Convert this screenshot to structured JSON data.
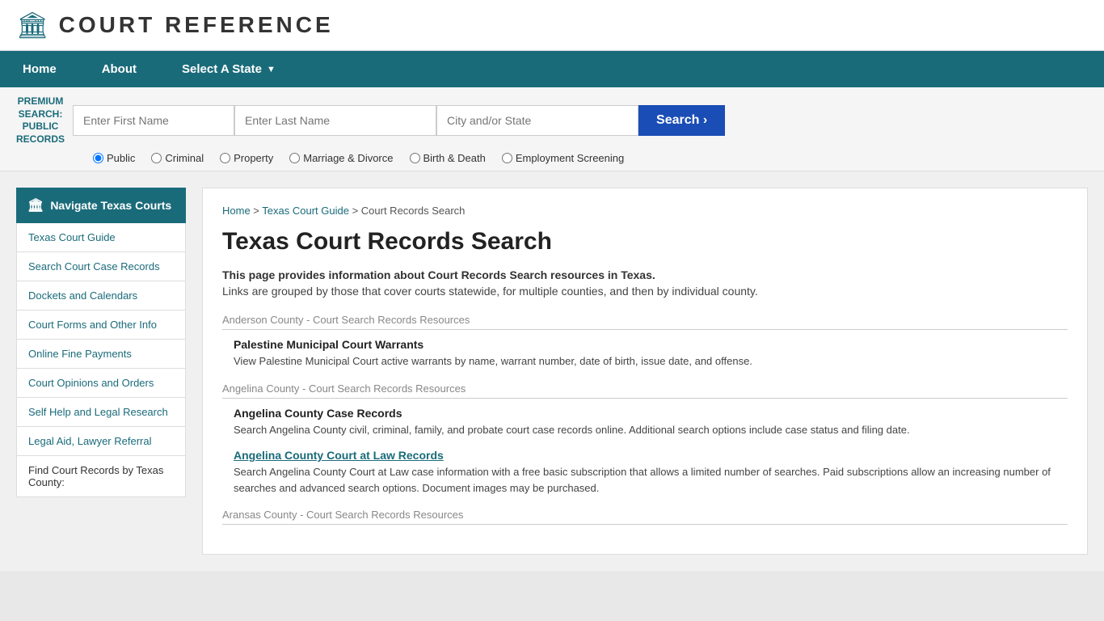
{
  "header": {
    "logo_icon": "🏛",
    "site_title": "COURT REFERENCE"
  },
  "nav": {
    "items": [
      {
        "label": "Home",
        "has_arrow": false
      },
      {
        "label": "About",
        "has_arrow": false
      },
      {
        "label": "Select A State",
        "has_arrow": true
      }
    ]
  },
  "search_bar": {
    "premium_label": "PREMIUM\nSEARCH:\nPUBLIC\nRECORDS",
    "first_name_placeholder": "Enter First Name",
    "last_name_placeholder": "Enter Last Name",
    "city_placeholder": "City and/or State",
    "button_label": "Search  ›",
    "radio_options": [
      "Public",
      "Criminal",
      "Property",
      "Marriage & Divorce",
      "Birth & Death",
      "Employment Screening"
    ],
    "radio_selected": "Public"
  },
  "breadcrumb": {
    "home": "Home",
    "state": "Texas Court Guide",
    "current": "Court Records Search"
  },
  "page": {
    "title": "Texas Court Records Search",
    "intro_bold": "This page provides information about Court Records Search resources in Texas.",
    "intro_text": "Links are grouped by those that cover courts statewide, for multiple counties, and then by individual county."
  },
  "sidebar": {
    "header_label": "Navigate Texas Courts",
    "links": [
      "Texas Court Guide",
      "Search Court Case Records",
      "Dockets and Calendars",
      "Court Forms and Other Info",
      "Online Fine Payments",
      "Court Opinions and Orders",
      "Self Help and Legal Research",
      "Legal Aid, Lawyer Referral"
    ],
    "footer_text": "Find Court Records by Texas County:"
  },
  "counties": [
    {
      "name": "Anderson County - Court Search Records Resources",
      "resources": [
        {
          "title": "Palestine Municipal Court Warrants",
          "is_link": false,
          "link_text": "",
          "description": "View Palestine Municipal Court active warrants by name, warrant number, date of birth, issue date, and offense."
        }
      ]
    },
    {
      "name": "Angelina County - Court Search Records Resources",
      "resources": [
        {
          "title": "Angelina County Case Records",
          "is_link": false,
          "link_text": "",
          "description": "Search Angelina County civil, criminal, family, and probate court case records online. Additional search options include case status and filing date."
        },
        {
          "title": "",
          "is_link": true,
          "link_text": "Angelina County Court at Law Records",
          "description": "Search Angelina County Court at Law case information with a free basic subscription that allows a limited number of searches. Paid subscriptions allow an increasing number of searches and advanced search options. Document images may be purchased."
        }
      ]
    },
    {
      "name": "Aransas County - Court Search Records Resources",
      "resources": []
    }
  ]
}
